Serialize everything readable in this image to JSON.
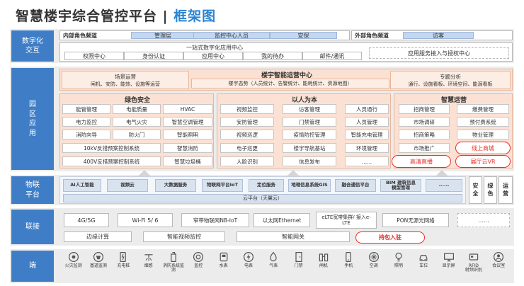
{
  "title": {
    "main": "智慧楼宇综合管控平台 | ",
    "highlight": "框架图"
  },
  "layers": {
    "interaction": "数字化\n交互",
    "park": "园\n区\n应\n用",
    "iot": "物联\n平台",
    "connect": "联接",
    "edge": "端"
  },
  "interaction": {
    "internal_label": "内部角色频道",
    "internal_items": [
      "管理层",
      "监控中心人员",
      "安保"
    ],
    "external_label": "外部角色频道",
    "external_items": [
      "访客"
    ],
    "center_title": "一站式数字化应用中心",
    "center_items": [
      "权限中心",
      "身份认证",
      "应用中心",
      "我的待办",
      "邮件/通讯"
    ],
    "service_portal": "应用服务接入与授权中心"
  },
  "ops_center": {
    "title": "楼宇智能运营中心",
    "left_title": "场景运营",
    "left_sub": "闸机、安防、能效、设施等运营",
    "middle_sub": "楼宇态势（人员统计、告警统计、能耗统计、资源地图）",
    "right_title": "专题分析",
    "right_sub": "通行、设施看板、环境空间、能源看板"
  },
  "green": {
    "title": "绿色安全",
    "rows": [
      [
        "能管管理",
        "电能质量",
        "HVAC"
      ],
      [
        "电力监控",
        "电气火灾",
        "智慧空调管理"
      ],
      [
        "消防向导",
        "防火门",
        "智能照明"
      ]
    ],
    "wide_rows": [
      [
        "10kV反措预案控制系统",
        "智慧消防"
      ],
      [
        "400V反措预案控制系统",
        "智慧垃圾桶"
      ]
    ]
  },
  "people": {
    "title": "以人为本",
    "rows": [
      [
        "视频监控",
        "访客管理",
        "人员通行"
      ],
      [
        "安防管理",
        "门禁管理",
        "人员管理"
      ],
      [
        "视频巡逻",
        "疫情防控管理",
        "智能充电管理"
      ],
      [
        "电子巡更",
        "楼宇导航基站",
        "环境管理"
      ],
      [
        "人脸识别",
        "信息发布",
        "......"
      ]
    ]
  },
  "smart_ops": {
    "title": "智慧运营",
    "rows": [
      [
        "招商管理",
        "缴费管理"
      ],
      [
        "市场调研",
        "预付费系统"
      ],
      [
        "招商策略",
        "物业管理"
      ],
      [
        "市场推广"
      ]
    ],
    "red_items": [
      "线上商城",
      "高清直播",
      "展厅云VR"
    ]
  },
  "iot": {
    "buttons": [
      "AI人工智能",
      "视频云",
      "大数据服务",
      "物联网平台IoT",
      "定位服务",
      "地理信息系统GIS",
      "融合通信平台",
      "BIM 建筑信息\n模型管理",
      "......"
    ],
    "cloud_label": "云平台（天翼云）",
    "side": [
      "安\n全",
      "绿\n色",
      "运\n营"
    ]
  },
  "connect": {
    "row1": [
      "4G/5G",
      "Wi-Fi 5/ 6",
      "窄带物联网NB-IoT",
      "以太网Ethernet",
      "eLTE宽带集群/ 接入e-\nLTE",
      "PON无源光网络",
      "......"
    ],
    "row2": [
      "边缘计算",
      "智能视频监控",
      "智能网关"
    ],
    "red_item": "持包入驻"
  },
  "devices": [
    {
      "icon": "fire-alarm-icon",
      "label": "火灾监测"
    },
    {
      "icon": "basement-icon",
      "label": "基道监测"
    },
    {
      "icon": "charger-icon",
      "label": "充电桩"
    },
    {
      "icon": "sprinkler-icon",
      "label": "烟感"
    },
    {
      "icon": "hydrant-icon",
      "label": "消防系统监\n测"
    },
    {
      "icon": "camera-icon",
      "label": "监控"
    },
    {
      "icon": "water-meter-icon",
      "label": "水表"
    },
    {
      "icon": "power-meter-icon",
      "label": "电表"
    },
    {
      "icon": "gas-meter-icon",
      "label": "气表"
    },
    {
      "icon": "door-icon",
      "label": "门禁"
    },
    {
      "icon": "gate-icon",
      "label": "闸机"
    },
    {
      "icon": "phone-icon",
      "label": "手机"
    },
    {
      "icon": "ac-icon",
      "label": "空调"
    },
    {
      "icon": "light-icon",
      "label": "照明"
    },
    {
      "icon": "parking-icon",
      "label": "车位"
    },
    {
      "icon": "display-icon",
      "label": "显示屏"
    },
    {
      "icon": "rfid-icon",
      "label": "RFID\n射频识别"
    },
    {
      "icon": "conference-icon",
      "label": "会议室"
    }
  ],
  "colors": {
    "layer_blue": "#3f7ec6",
    "peach": "#fbe1d3",
    "red": "#e5322d",
    "title_blue": "#2b84d3"
  }
}
